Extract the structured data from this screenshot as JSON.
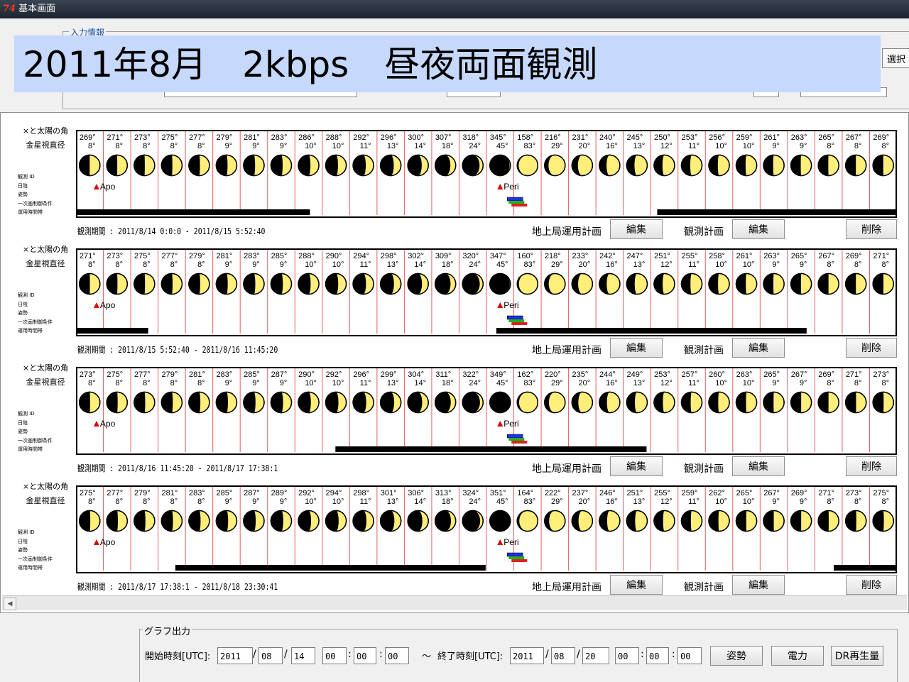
{
  "window": {
    "title": "基本画面",
    "icon": "app-logo-icon"
  },
  "input_info": {
    "legend": "入力情報",
    "select_button": "選択"
  },
  "overlay": {
    "text": "2011年8月　2kbps　昼夜両面観測"
  },
  "row_labels": {
    "line1": "×と太陽の角",
    "line2": "金星視直径",
    "small": [
      "観測 ID",
      "日陰",
      "姿勢",
      "一次画制御条件",
      "運用時間帯"
    ]
  },
  "marker_labels": {
    "apo": "Apo",
    "peri": "Peri"
  },
  "buttons": {
    "ground_plan": "地上局運用計画",
    "edit": "編集",
    "obs_plan": "観測計画",
    "delete": "削除"
  },
  "rows": [
    {
      "period": "観測期間 : 2011/8/14 0:0:0 - 2011/8/15 5:52:40",
      "angles": [
        "269°",
        "271°",
        "273°",
        "275°",
        "277°",
        "279°",
        "281°",
        "283°",
        "286°",
        "288°",
        "292°",
        "296°",
        "300°",
        "307°",
        "318°",
        "345°",
        "158°",
        "216°",
        "231°",
        "240°",
        "245°",
        "250°",
        "253°",
        "256°",
        "259°",
        "261°",
        "263°",
        "265°",
        "267°",
        "269°"
      ],
      "diameters": [
        "8°",
        "8°",
        "8°",
        "8°",
        "8°",
        "9°",
        "9°",
        "9°",
        "10°",
        "10°",
        "11°",
        "13°",
        "14°",
        "18°",
        "24°",
        "45°",
        "83°",
        "29°",
        "20°",
        "16°",
        "13°",
        "12°",
        "11°",
        "10°",
        "10°",
        "9°",
        "9°",
        "8°",
        "8°",
        "8°"
      ],
      "phases": [
        0.5,
        0.51,
        0.52,
        0.53,
        0.54,
        0.55,
        0.56,
        0.57,
        0.59,
        0.6,
        0.62,
        0.65,
        0.68,
        0.74,
        0.83,
        0.96,
        0.07,
        0.19,
        0.29,
        0.35,
        0.38,
        0.41,
        0.43,
        0.44,
        0.46,
        0.47,
        0.48,
        0.49,
        0.5,
        0.5
      ],
      "bars": [
        [
          0.0,
          0.285
        ],
        [
          0.708,
          1.0
        ]
      ]
    },
    {
      "period": "観測期間 : 2011/8/15 5:52:40 - 2011/8/16 11:45:20",
      "angles": [
        "271°",
        "273°",
        "275°",
        "277°",
        "279°",
        "281°",
        "283°",
        "285°",
        "288°",
        "290°",
        "294°",
        "298°",
        "302°",
        "309°",
        "320°",
        "347°",
        "160°",
        "218°",
        "233°",
        "242°",
        "247°",
        "251°",
        "255°",
        "258°",
        "261°",
        "263°",
        "265°",
        "267°",
        "269°",
        "271°"
      ],
      "diameters": [
        "8°",
        "8°",
        "8°",
        "8°",
        "8°",
        "9°",
        "9°",
        "9°",
        "10°",
        "10°",
        "11°",
        "13°",
        "14°",
        "18°",
        "24°",
        "45°",
        "83°",
        "29°",
        "20°",
        "16°",
        "13°",
        "12°",
        "11°",
        "10°",
        "10°",
        "9°",
        "9°",
        "8°",
        "8°",
        "8°"
      ],
      "phases": [
        0.51,
        0.52,
        0.53,
        0.54,
        0.55,
        0.56,
        0.57,
        0.58,
        0.6,
        0.61,
        0.63,
        0.66,
        0.69,
        0.75,
        0.84,
        0.97,
        0.08,
        0.2,
        0.3,
        0.36,
        0.39,
        0.42,
        0.44,
        0.45,
        0.47,
        0.48,
        0.49,
        0.5,
        0.5,
        0.51
      ],
      "bars": [
        [
          0.0,
          0.088
        ],
        [
          0.512,
          0.89
        ]
      ]
    },
    {
      "period": "観測期間 : 2011/8/16 11:45:20 - 2011/8/17 17:38:1",
      "angles": [
        "273°",
        "275°",
        "277°",
        "279°",
        "281°",
        "283°",
        "285°",
        "287°",
        "290°",
        "292°",
        "296°",
        "299°",
        "304°",
        "311°",
        "322°",
        "349°",
        "162°",
        "220°",
        "235°",
        "244°",
        "249°",
        "253°",
        "257°",
        "260°",
        "263°",
        "265°",
        "267°",
        "269°",
        "271°",
        "273°"
      ],
      "diameters": [
        "8°",
        "8°",
        "8°",
        "8°",
        "8°",
        "9°",
        "9°",
        "9°",
        "10°",
        "10°",
        "11°",
        "13°",
        "14°",
        "18°",
        "24°",
        "45°",
        "83°",
        "29°",
        "20°",
        "16°",
        "13°",
        "12°",
        "11°",
        "10°",
        "10°",
        "9°",
        "9°",
        "8°",
        "8°",
        "8°"
      ],
      "phases": [
        0.52,
        0.53,
        0.54,
        0.55,
        0.56,
        0.57,
        0.58,
        0.59,
        0.61,
        0.62,
        0.64,
        0.67,
        0.7,
        0.76,
        0.85,
        0.98,
        0.09,
        0.21,
        0.31,
        0.37,
        0.4,
        0.43,
        0.45,
        0.46,
        0.48,
        0.49,
        0.5,
        0.5,
        0.51,
        0.52
      ],
      "bars": [
        [
          0.316,
          0.695
        ]
      ]
    },
    {
      "period": "観測期間 : 2011/8/17 17:38:1 - 2011/8/18 23:30:41",
      "angles": [
        "275°",
        "277°",
        "279°",
        "281°",
        "283°",
        "285°",
        "287°",
        "289°",
        "292°",
        "294°",
        "298°",
        "301°",
        "306°",
        "313°",
        "324°",
        "351°",
        "164°",
        "222°",
        "237°",
        "246°",
        "251°",
        "255°",
        "259°",
        "262°",
        "265°",
        "267°",
        "269°",
        "271°",
        "273°",
        "275°"
      ],
      "diameters": [
        "8°",
        "8°",
        "8°",
        "8°",
        "8°",
        "9°",
        "9°",
        "9°",
        "10°",
        "10°",
        "11°",
        "13°",
        "14°",
        "18°",
        "24°",
        "45°",
        "83°",
        "29°",
        "20°",
        "16°",
        "13°",
        "12°",
        "11°",
        "10°",
        "10°",
        "9°",
        "9°",
        "8°",
        "8°",
        "8°"
      ],
      "phases": [
        0.53,
        0.54,
        0.55,
        0.56,
        0.57,
        0.58,
        0.59,
        0.6,
        0.62,
        0.63,
        0.65,
        0.68,
        0.71,
        0.77,
        0.86,
        0.98,
        0.1,
        0.22,
        0.32,
        0.38,
        0.41,
        0.44,
        0.46,
        0.47,
        0.49,
        0.5,
        0.5,
        0.51,
        0.52,
        0.53
      ],
      "bars": [
        [
          0.121,
          0.499
        ],
        [
          0.923,
          1.0
        ]
      ]
    }
  ],
  "graph_output": {
    "legend": "グラフ出力",
    "start_label": "開始時刻[UTC]:",
    "tilde": "～",
    "end_label": "終了時刻[UTC]:",
    "start": {
      "year": "2011",
      "month": "08",
      "day": "14",
      "hour": "00",
      "minute": "00",
      "second": "00"
    },
    "end": {
      "year": "2011",
      "month": "08",
      "day": "20",
      "hour": "00",
      "minute": "00",
      "second": "00"
    },
    "slash": "/",
    "colon": ":",
    "buttons": {
      "attitude": "姿勢",
      "power": "電力",
      "dr": "DR再生量"
    }
  },
  "colors": {
    "moon_lit": "#ffee7a",
    "moon_dark": "#000000",
    "grid_line": "#e06060",
    "apo_marker": "#e00000",
    "band_blue": "#2030e0",
    "band_green": "#20b020",
    "band_red": "#e02020",
    "overlay_bg": "#c6d8fb"
  }
}
